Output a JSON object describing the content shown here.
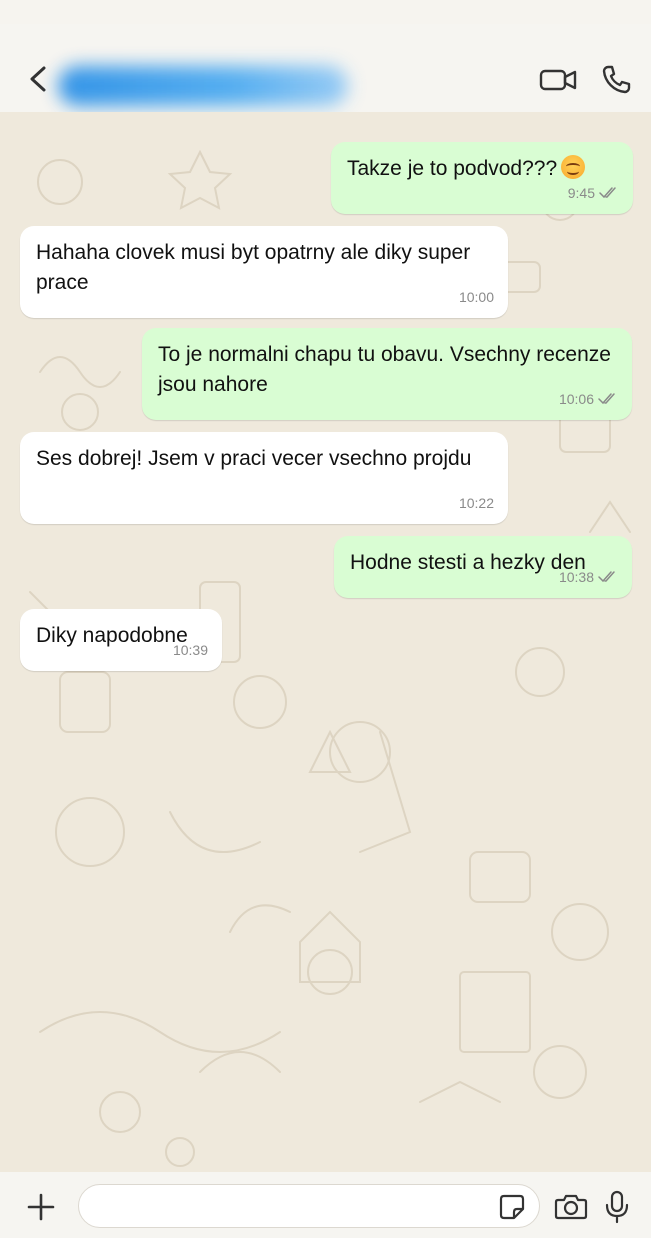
{
  "header": {
    "contact_name": "",
    "back_icon": "arrow-left-icon",
    "video_icon": "video-camera-icon",
    "call_icon": "phone-icon"
  },
  "messages": [
    {
      "direction": "outgoing",
      "text": "Takze je to podvod???",
      "emoji": "smiling-face",
      "time": "9:45",
      "read": true
    },
    {
      "direction": "incoming",
      "text": "Hahaha clovek musi byt opatrny ale diky super prace",
      "time": "10:00"
    },
    {
      "direction": "outgoing",
      "text": "To je normalni chapu tu obavu. Vsechny recenze jsou nahore",
      "time": "10:06",
      "read": true
    },
    {
      "direction": "incoming",
      "text": "Ses dobrej! Jsem v praci vecer vsechno projdu",
      "time": "10:22"
    },
    {
      "direction": "outgoing",
      "text": "Hodne stesti a hezky den",
      "time": "10:38",
      "read": true
    },
    {
      "direction": "incoming",
      "text": "Diky napodobne",
      "time": "10:39"
    }
  ],
  "composer": {
    "value": "",
    "placeholder": "",
    "attach_icon": "plus-icon",
    "sticker_icon": "sticker-icon",
    "camera_icon": "camera-icon",
    "mic_icon": "microphone-icon"
  },
  "colors": {
    "outgoing_bubble": "#d9fdd3",
    "incoming_bubble": "#ffffff",
    "chat_background": "#efe9dc",
    "contact_blur": "#2b8fe8",
    "read_ticks": "#8a8a8a"
  }
}
